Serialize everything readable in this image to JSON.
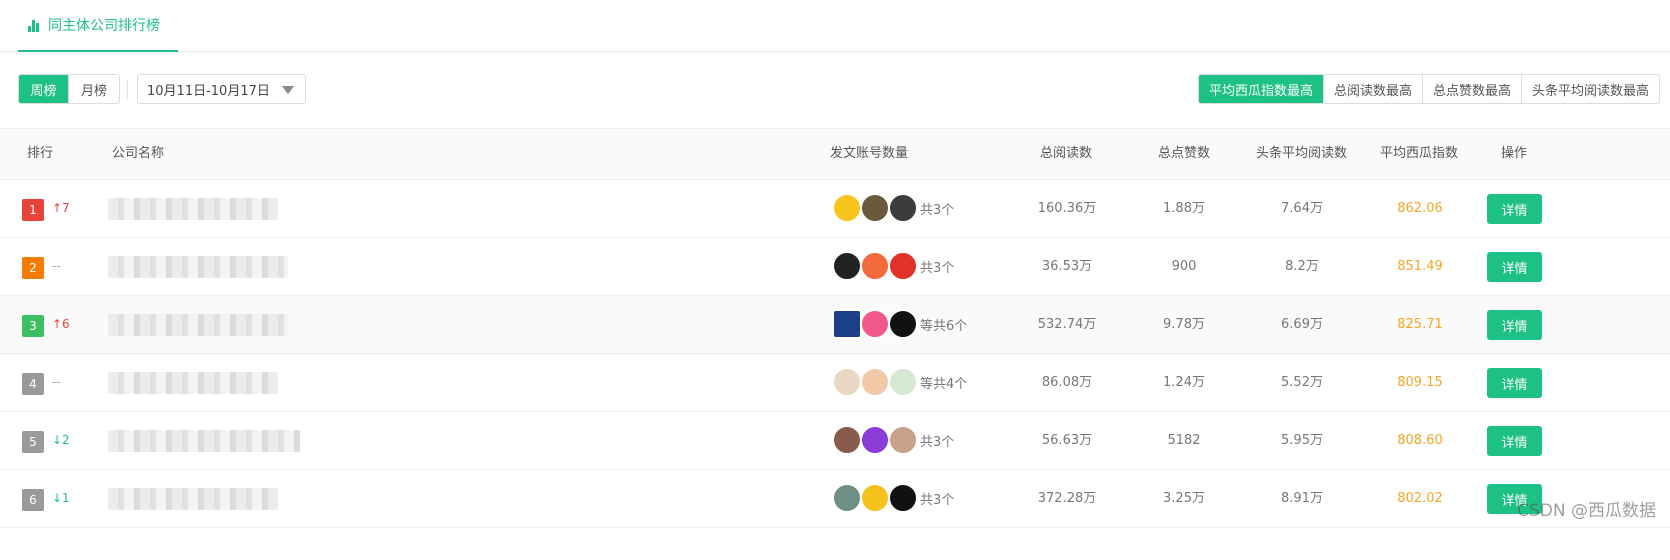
{
  "header": {
    "tab_label": "同主体公司排行榜",
    "tab_icon": "bar-chart-icon"
  },
  "filters": {
    "period_options": [
      "周榜",
      "月榜"
    ],
    "period_selected": "周榜",
    "date_range": "10月11日-10月17日",
    "sort_options": [
      "平均西瓜指数最高",
      "总阅读数最高",
      "总点赞数最高",
      "头条平均阅读数最高"
    ],
    "sort_selected": "平均西瓜指数最高"
  },
  "table": {
    "columns": [
      "排行",
      "公司名称",
      "发文账号数量",
      "总阅读数",
      "总点赞数",
      "头条平均阅读数",
      "平均西瓜指数",
      "操作"
    ],
    "rows": [
      {
        "rank": "1",
        "change": "↑7",
        "dir": "up",
        "accounts": "共3个",
        "total_reads": "160.36万",
        "total_likes": "1.88万",
        "head_avg_reads": "7.64万",
        "score": "862.06",
        "action": "详情"
      },
      {
        "rank": "2",
        "change": "--",
        "dir": "same",
        "accounts": "共3个",
        "total_reads": "36.53万",
        "total_likes": "900",
        "head_avg_reads": "8.2万",
        "score": "851.49",
        "action": "详情"
      },
      {
        "rank": "3",
        "change": "↑6",
        "dir": "up",
        "accounts": "等共6个",
        "total_reads": "532.74万",
        "total_likes": "9.78万",
        "head_avg_reads": "6.69万",
        "score": "825.71",
        "action": "详情"
      },
      {
        "rank": "4",
        "change": "--",
        "dir": "same",
        "accounts": "等共4个",
        "total_reads": "86.08万",
        "total_likes": "1.24万",
        "head_avg_reads": "5.52万",
        "score": "809.15",
        "action": "详情"
      },
      {
        "rank": "5",
        "change": "↓2",
        "dir": "down",
        "accounts": "共3个",
        "total_reads": "56.63万",
        "total_likes": "5182",
        "head_avg_reads": "5.95万",
        "score": "808.60",
        "action": "详情"
      },
      {
        "rank": "6",
        "change": "↓1",
        "dir": "down",
        "accounts": "共3个",
        "total_reads": "372.28万",
        "total_likes": "3.25万",
        "head_avg_reads": "8.91万",
        "score": "802.02",
        "action": "详情"
      }
    ]
  },
  "colors": {
    "accent": "#1ec185",
    "score": "#f5a623",
    "up": "#e8433a",
    "down": "#1ec185",
    "rank1": "#e8433a",
    "rank2": "#f57c00",
    "rank3": "#3cbf63",
    "rank_other": "#9a9a9a"
  },
  "watermark": "CSDN @西瓜数据"
}
